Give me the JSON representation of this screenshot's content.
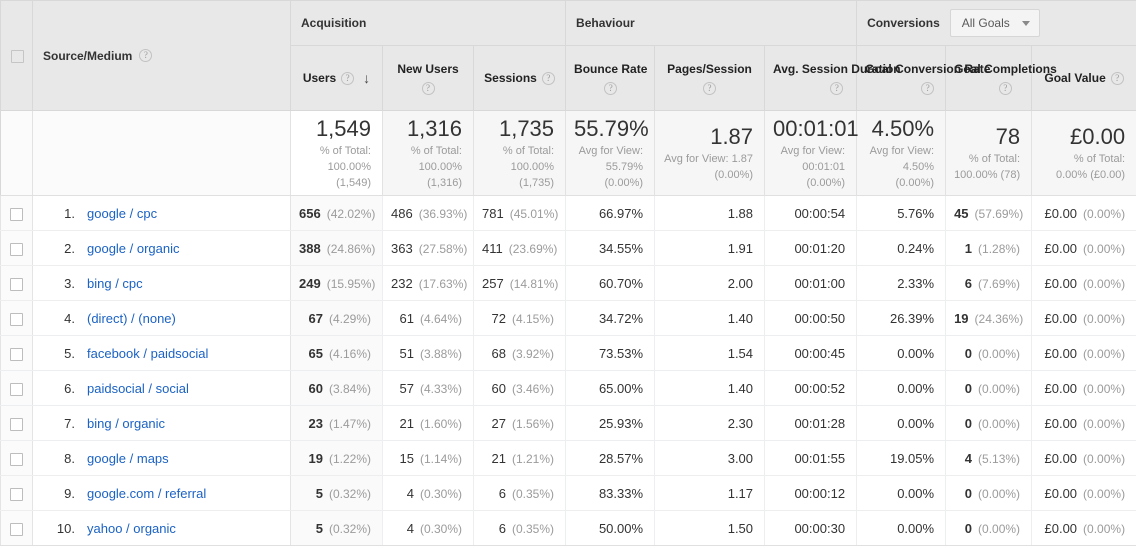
{
  "table": {
    "groups": [
      {
        "label": "",
        "key": "dimension-group"
      },
      {
        "label": "Acquisition",
        "key": "acquisition"
      },
      {
        "label": "Behaviour",
        "key": "behaviour"
      },
      {
        "label": "Conversions",
        "key": "conversions"
      }
    ],
    "conversions_selector": {
      "label": "Conversions",
      "selected_goal": "All Goals",
      "caret_icon": "chevron-down-icon"
    },
    "dimension_header": {
      "label": "Source/Medium",
      "help_icon": "help-question-icon"
    },
    "select_all_checkbox": "select-all-checkbox",
    "columns": [
      {
        "label": "Users",
        "help_icon": "help-question-icon",
        "sorted": true,
        "sort_icon": "sort-descending-arrow"
      },
      {
        "label": "New Users",
        "help_icon": "help-question-icon",
        "sorted": false
      },
      {
        "label": "Sessions",
        "help_icon": "help-question-icon",
        "sorted": false
      },
      {
        "label": "Bounce Rate",
        "help_icon": "help-question-icon",
        "sorted": false
      },
      {
        "label": "Pages/Session",
        "help_icon": "help-question-icon",
        "sorted": false
      },
      {
        "label": "Avg. Session Duration",
        "help_icon": "help-question-icon",
        "sorted": false
      },
      {
        "label": "Goal Conversion Rate",
        "help_icon": "help-question-icon",
        "sorted": false
      },
      {
        "label": "Goal Completions",
        "help_icon": "help-question-icon",
        "sorted": false
      },
      {
        "label": "Goal Value",
        "help_icon": "help-question-icon",
        "sorted": false
      }
    ],
    "summary": [
      {
        "value": "1,549",
        "note1": "% of Total:",
        "note2": "100.00%",
        "note3": "(1,549)"
      },
      {
        "value": "1,316",
        "note1": "% of Total:",
        "note2": "100.00%",
        "note3": "(1,316)"
      },
      {
        "value": "1,735",
        "note1": "% of Total:",
        "note2": "100.00%",
        "note3": "(1,735)"
      },
      {
        "value": "55.79%",
        "note1": "Avg for View:",
        "note2": "55.79%",
        "note3": "(0.00%)"
      },
      {
        "value": "1.87",
        "note1": "Avg for View: 1.87",
        "note2": "(0.00%)",
        "note3": ""
      },
      {
        "value": "00:01:01",
        "note1": "Avg for View:",
        "note2": "00:01:01",
        "note3": "(0.00%)"
      },
      {
        "value": "4.50%",
        "note1": "Avg for View:",
        "note2": "4.50%",
        "note3": "(0.00%)"
      },
      {
        "value": "78",
        "note1": "% of Total:",
        "note2": "100.00% (78)",
        "note3": ""
      },
      {
        "value": "£0.00",
        "note1": "% of Total:",
        "note2": "0.00% (£0.00)",
        "note3": ""
      }
    ],
    "rows": [
      {
        "index": "1.",
        "source": "google / cpc",
        "users": "656",
        "users_pct": "(42.02%)",
        "new_users": "486",
        "new_users_pct": "(36.93%)",
        "sessions": "781",
        "sessions_pct": "(45.01%)",
        "bounce_rate": "66.97%",
        "pages_session": "1.88",
        "avg_duration": "00:00:54",
        "goal_conv_rate": "5.76%",
        "goal_completions": "45",
        "goal_completions_pct": "(57.69%)",
        "goal_value": "£0.00",
        "goal_value_pct": "(0.00%)"
      },
      {
        "index": "2.",
        "source": "google / organic",
        "users": "388",
        "users_pct": "(24.86%)",
        "new_users": "363",
        "new_users_pct": "(27.58%)",
        "sessions": "411",
        "sessions_pct": "(23.69%)",
        "bounce_rate": "34.55%",
        "pages_session": "1.91",
        "avg_duration": "00:01:20",
        "goal_conv_rate": "0.24%",
        "goal_completions": "1",
        "goal_completions_pct": "(1.28%)",
        "goal_value": "£0.00",
        "goal_value_pct": "(0.00%)"
      },
      {
        "index": "3.",
        "source": "bing / cpc",
        "users": "249",
        "users_pct": "(15.95%)",
        "new_users": "232",
        "new_users_pct": "(17.63%)",
        "sessions": "257",
        "sessions_pct": "(14.81%)",
        "bounce_rate": "60.70%",
        "pages_session": "2.00",
        "avg_duration": "00:01:00",
        "goal_conv_rate": "2.33%",
        "goal_completions": "6",
        "goal_completions_pct": "(7.69%)",
        "goal_value": "£0.00",
        "goal_value_pct": "(0.00%)"
      },
      {
        "index": "4.",
        "source": "(direct) / (none)",
        "users": "67",
        "users_pct": "(4.29%)",
        "new_users": "61",
        "new_users_pct": "(4.64%)",
        "sessions": "72",
        "sessions_pct": "(4.15%)",
        "bounce_rate": "34.72%",
        "pages_session": "1.40",
        "avg_duration": "00:00:50",
        "goal_conv_rate": "26.39%",
        "goal_completions": "19",
        "goal_completions_pct": "(24.36%)",
        "goal_value": "£0.00",
        "goal_value_pct": "(0.00%)"
      },
      {
        "index": "5.",
        "source": "facebook / paidsocial",
        "users": "65",
        "users_pct": "(4.16%)",
        "new_users": "51",
        "new_users_pct": "(3.88%)",
        "sessions": "68",
        "sessions_pct": "(3.92%)",
        "bounce_rate": "73.53%",
        "pages_session": "1.54",
        "avg_duration": "00:00:45",
        "goal_conv_rate": "0.00%",
        "goal_completions": "0",
        "goal_completions_pct": "(0.00%)",
        "goal_value": "£0.00",
        "goal_value_pct": "(0.00%)"
      },
      {
        "index": "6.",
        "source": "paidsocial / social",
        "users": "60",
        "users_pct": "(3.84%)",
        "new_users": "57",
        "new_users_pct": "(4.33%)",
        "sessions": "60",
        "sessions_pct": "(3.46%)",
        "bounce_rate": "65.00%",
        "pages_session": "1.40",
        "avg_duration": "00:00:52",
        "goal_conv_rate": "0.00%",
        "goal_completions": "0",
        "goal_completions_pct": "(0.00%)",
        "goal_value": "£0.00",
        "goal_value_pct": "(0.00%)"
      },
      {
        "index": "7.",
        "source": "bing / organic",
        "users": "23",
        "users_pct": "(1.47%)",
        "new_users": "21",
        "new_users_pct": "(1.60%)",
        "sessions": "27",
        "sessions_pct": "(1.56%)",
        "bounce_rate": "25.93%",
        "pages_session": "2.30",
        "avg_duration": "00:01:28",
        "goal_conv_rate": "0.00%",
        "goal_completions": "0",
        "goal_completions_pct": "(0.00%)",
        "goal_value": "£0.00",
        "goal_value_pct": "(0.00%)"
      },
      {
        "index": "8.",
        "source": "google / maps",
        "users": "19",
        "users_pct": "(1.22%)",
        "new_users": "15",
        "new_users_pct": "(1.14%)",
        "sessions": "21",
        "sessions_pct": "(1.21%)",
        "bounce_rate": "28.57%",
        "pages_session": "3.00",
        "avg_duration": "00:01:55",
        "goal_conv_rate": "19.05%",
        "goal_completions": "4",
        "goal_completions_pct": "(5.13%)",
        "goal_value": "£0.00",
        "goal_value_pct": "(0.00%)"
      },
      {
        "index": "9.",
        "source": "google.com / referral",
        "users": "5",
        "users_pct": "(0.32%)",
        "new_users": "4",
        "new_users_pct": "(0.30%)",
        "sessions": "6",
        "sessions_pct": "(0.35%)",
        "bounce_rate": "83.33%",
        "pages_session": "1.17",
        "avg_duration": "00:00:12",
        "goal_conv_rate": "0.00%",
        "goal_completions": "0",
        "goal_completions_pct": "(0.00%)",
        "goal_value": "£0.00",
        "goal_value_pct": "(0.00%)"
      },
      {
        "index": "10.",
        "source": "yahoo / organic",
        "users": "5",
        "users_pct": "(0.32%)",
        "new_users": "4",
        "new_users_pct": "(0.30%)",
        "sessions": "6",
        "sessions_pct": "(0.35%)",
        "bounce_rate": "50.00%",
        "pages_session": "1.50",
        "avg_duration": "00:00:30",
        "goal_conv_rate": "0.00%",
        "goal_completions": "0",
        "goal_completions_pct": "(0.00%)",
        "goal_value": "£0.00",
        "goal_value_pct": "(0.00%)"
      }
    ]
  },
  "colors": {
    "link": "#1b62c4",
    "header_bg": "#e8e8e8",
    "summary_bg": "#f6f6f6",
    "muted_text": "#9b9b9b",
    "text": "#333333"
  },
  "icons": {
    "help": "?",
    "sort_desc": "↓"
  }
}
